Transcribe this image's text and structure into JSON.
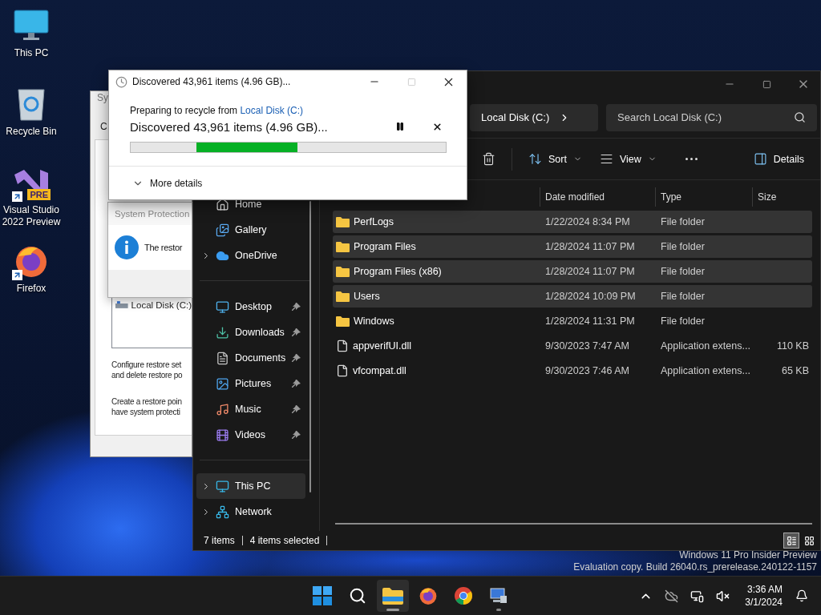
{
  "desktop_icons": [
    {
      "kind": "pc",
      "label": "This PC",
      "shortcut": false
    },
    {
      "kind": "recycle",
      "label": "Recycle Bin",
      "shortcut": false
    },
    {
      "kind": "vs",
      "label": "Visual Studio 2022 Preview",
      "badge": "PRE",
      "shortcut": true
    },
    {
      "kind": "firefox",
      "label": "Firefox",
      "shortcut": true
    }
  ],
  "system_properties": {
    "title": "Sy",
    "tab": "C",
    "drive": "Local Disk (C:)",
    "paragraphs": [
      [
        "Configure restore set",
        "and delete restore po"
      ],
      [
        "Create a restore poin",
        "have system protecti"
      ]
    ]
  },
  "system_protection_dialog": {
    "title": "System Protection",
    "message": "The restor"
  },
  "explorer": {
    "breadcrumb": "Local Disk (C:)",
    "search": {
      "placeholder": "Search Local Disk (C:)"
    },
    "toolbar": [
      {
        "kind": "delete"
      },
      {
        "kind": "sort",
        "label": "Sort"
      },
      {
        "kind": "view",
        "label": "View"
      },
      {
        "kind": "more"
      },
      {
        "kind": "details",
        "label": "Details"
      }
    ],
    "sidebar": [
      {
        "items": [
          {
            "kind": "home",
            "label": "Home",
            "expandable": false,
            "pinned": false,
            "selected": false
          },
          {
            "kind": "gallery",
            "label": "Gallery",
            "expandable": false,
            "pinned": false,
            "selected": false
          },
          {
            "kind": "onedrive",
            "label": "OneDrive",
            "expandable": true,
            "pinned": false,
            "selected": false
          }
        ]
      },
      {
        "items": [
          {
            "kind": "desktop",
            "label": "Desktop",
            "expandable": false,
            "pinned": true,
            "selected": false
          },
          {
            "kind": "downloads",
            "label": "Downloads",
            "expandable": false,
            "pinned": true,
            "selected": false
          },
          {
            "kind": "documents",
            "label": "Documents",
            "expandable": false,
            "pinned": true,
            "selected": false
          },
          {
            "kind": "pictures",
            "label": "Pictures",
            "expandable": false,
            "pinned": true,
            "selected": false
          },
          {
            "kind": "music",
            "label": "Music",
            "expandable": false,
            "pinned": true,
            "selected": false
          },
          {
            "kind": "videos",
            "label": "Videos",
            "expandable": false,
            "pinned": true,
            "selected": false
          }
        ]
      },
      {
        "items": [
          {
            "kind": "pc",
            "label": "This PC",
            "expandable": true,
            "pinned": false,
            "selected": true
          },
          {
            "kind": "network",
            "label": "Network",
            "expandable": true,
            "pinned": false,
            "selected": false
          }
        ]
      }
    ],
    "columns": [
      "Date modified",
      "Type",
      "Size"
    ],
    "files": [
      {
        "kind": "folder",
        "name": "PerfLogs",
        "date": "1/22/2024 8:34 PM",
        "type": "File folder",
        "selected": true
      },
      {
        "kind": "folder",
        "name": "Program Files",
        "date": "1/28/2024 11:07 PM",
        "type": "File folder",
        "selected": true
      },
      {
        "kind": "folder",
        "name": "Program Files (x86)",
        "date": "1/28/2024 11:07 PM",
        "type": "File folder",
        "selected": true
      },
      {
        "kind": "folder",
        "name": "Users",
        "date": "1/28/2024 10:09 PM",
        "type": "File folder",
        "selected": true
      },
      {
        "kind": "folder",
        "name": "Windows",
        "date": "1/28/2024 11:31 PM",
        "type": "File folder",
        "selected": false
      },
      {
        "kind": "dll",
        "name": "appverifUI.dll",
        "date": "9/30/2023 7:47 AM",
        "type": "Application extens...",
        "size": "110 KB",
        "selected": false
      },
      {
        "kind": "dll",
        "name": "vfcompat.dll",
        "date": "9/30/2023 7:46 AM",
        "type": "Application extens...",
        "size": "65 KB",
        "selected": false
      }
    ],
    "status": [
      "7 items",
      "4 items selected"
    ],
    "view_modes": [
      {
        "kind": "details",
        "selected": true
      },
      {
        "kind": "tiles",
        "selected": false
      }
    ]
  },
  "recycle_dialog": {
    "title": "Discovered 43,961 items (4.96 GB)...",
    "progress": {
      "level": 0.32
    },
    "from_label": "Preparing to recycle from",
    "from_link": "Local Disk (C:)",
    "status": "Discovered 43,961 items (4.96 GB)...",
    "more": "More details"
  },
  "watermark": [
    "Windows 11 Pro Insider Preview",
    "Evaluation copy. Build 26040.rs_prerelease.240122-1157"
  ],
  "taskbar": {
    "apps": [
      {
        "kind": "start",
        "active": false,
        "running": false
      },
      {
        "kind": "search",
        "active": false,
        "running": false
      },
      {
        "kind": "explorer",
        "active": true,
        "running": true
      },
      {
        "kind": "firefox",
        "active": false,
        "running": false
      },
      {
        "kind": "chrome",
        "active": false,
        "running": false
      },
      {
        "kind": "system",
        "active": false,
        "running": true
      }
    ],
    "time": "3:36 AM",
    "date": "3/1/2024"
  }
}
